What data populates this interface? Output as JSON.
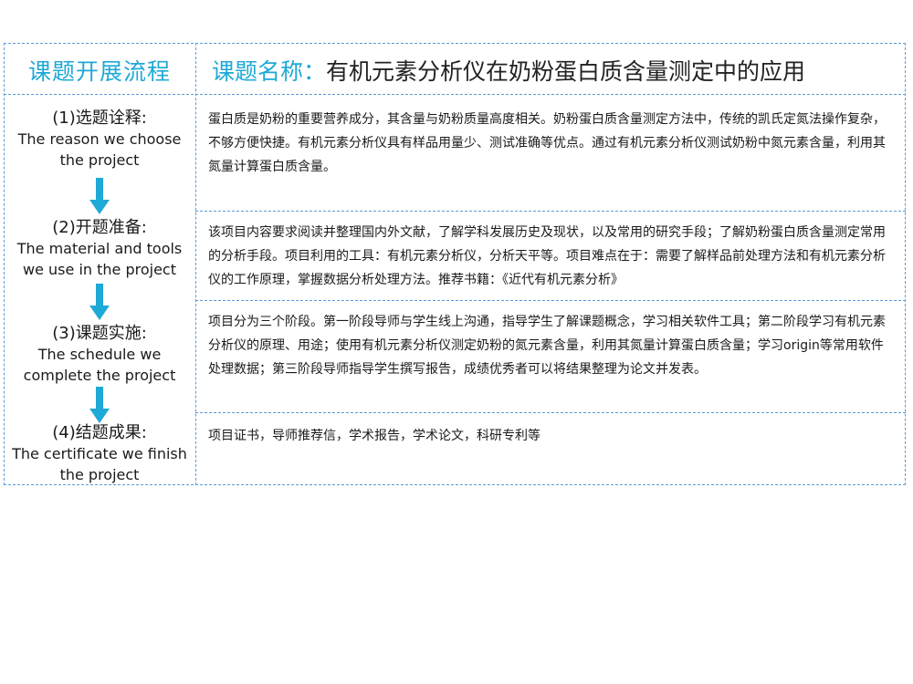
{
  "header": {
    "left_title": "课题开展流程",
    "right_label": "课题名称：",
    "right_title": "有机元素分析仪在奶粉蛋白质含量测定中的应用"
  },
  "steps": [
    {
      "title_zh": "(1)选题诠释:",
      "title_en": "The reason we choose the project",
      "description": "蛋白质是奶粉的重要营养成分，其含量与奶粉质量高度相关。奶粉蛋白质含量测定方法中，传统的凯氏定氮法操作复杂，不够方便快捷。有机元素分析仪具有样品用量少、测试准确等优点。通过有机元素分析仪测试奶粉中氮元素含量，利用其氮量计算蛋白质含量。"
    },
    {
      "title_zh": "(2)开题准备:",
      "title_en": "The material and tools we use in the project",
      "description": "该项目内容要求阅读并整理国内外文献，了解学科发展历史及现状，以及常用的研究手段；了解奶粉蛋白质含量测定常用的分析手段。项目利用的工具：有机元素分析仪，分析天平等。项目难点在于：需要了解样品前处理方法和有机元素分析仪的工作原理，掌握数据分析处理方法。推荐书籍：《近代有机元素分析》"
    },
    {
      "title_zh": "(3)课题实施:",
      "title_en": "The schedule we complete the project",
      "description": "项目分为三个阶段。第一阶段导师与学生线上沟通，指导学生了解课题概念，学习相关软件工具；第二阶段学习有机元素分析仪的原理、用途；使用有机元素分析仪测定奶粉的氮元素含量，利用其氮量计算蛋白质含量；学习origin等常用软件处理数据；第三阶段导师指导学生撰写报告，成绩优秀者可以将结果整理为论文并发表。"
    },
    {
      "title_zh": "(4)结题成果:",
      "title_en": "The certificate we finish the project",
      "description": "项目证书，导师推荐信，学术报告，学术论文，科研专利等"
    }
  ],
  "colors": {
    "accent": "#1fa9d6",
    "border": "#5b9bd5",
    "arrow": "#1fa9d6"
  }
}
